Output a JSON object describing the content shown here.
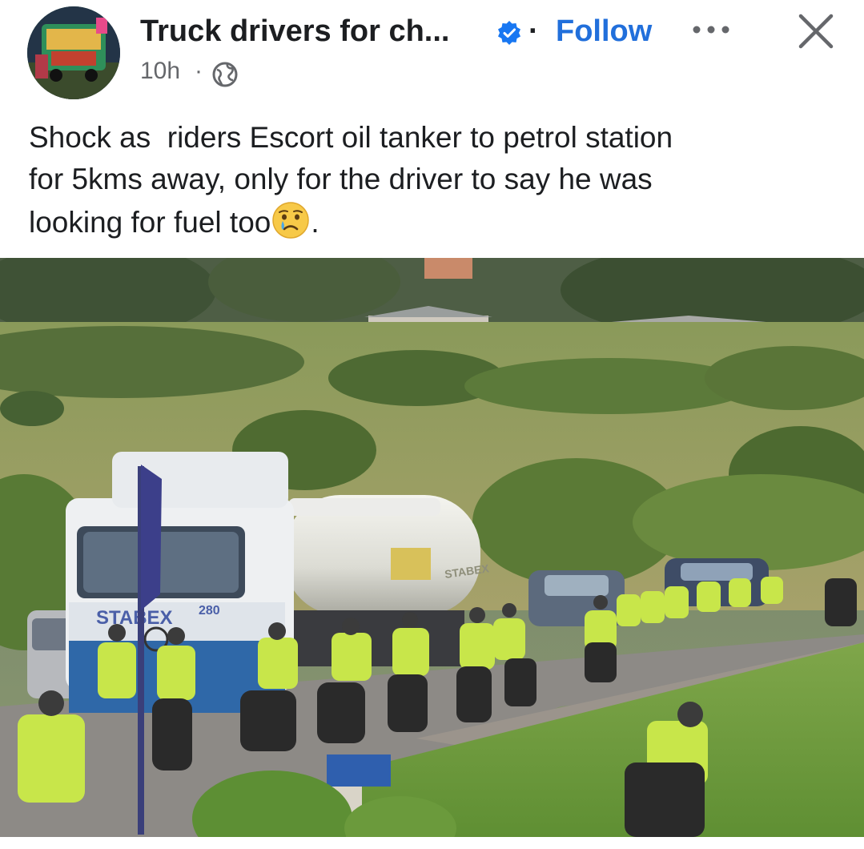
{
  "header": {
    "page_name": "Truck drivers for ch...",
    "separator": "·",
    "follow_label": "Follow",
    "time": "10h",
    "time_separator": "·",
    "icons": [
      "verified-badge-icon",
      "more-options-icon",
      "close-icon",
      "globe-icon"
    ]
  },
  "post": {
    "text_before_emoji": "Shock as  riders Escort oil tanker to petrol station\nfor 5kms away, only for the driver to say he was\nlooking for fuel too",
    "text_after_emoji": ".",
    "emoji": "crying-face-emoji"
  },
  "photo": {
    "tanker_brand": "STABEX",
    "tanker_number": "280",
    "tank_logo": "STABEX"
  },
  "colors": {
    "follow_blue": "#216fdb",
    "verified_blue": "#1877f2",
    "text_primary": "#1c1e21",
    "text_secondary": "#65676b"
  }
}
